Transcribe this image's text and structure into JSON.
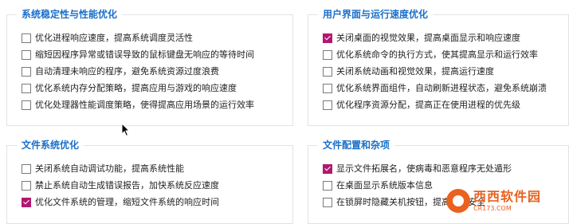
{
  "groups": [
    {
      "title": "系统稳定性与性能优化",
      "options": [
        {
          "label": "优化进程响应速度，提高系统调度灵活性",
          "checked": false
        },
        {
          "label": "缩短因程序异常或错误导致的鼠标键盘无响应的等待时间",
          "checked": false
        },
        {
          "label": "自动清理未响应的程序，避免系统资源过度浪费",
          "checked": false
        },
        {
          "label": "优化系统内存分配策略，提高应用与游戏的响应速度",
          "checked": false
        },
        {
          "label": "优化处理器性能调度策略，使得提高应用场景的运行效率",
          "checked": false
        }
      ]
    },
    {
      "title": "用户界面与运行速度优化",
      "options": [
        {
          "label": "关闭桌面的视觉效果，提高桌面显示和响应速度",
          "checked": true
        },
        {
          "label": "优化系统命令的执行方式，使其提高显示和运行效率",
          "checked": false
        },
        {
          "label": "关闭系统动画和视觉效果，提高运行速度",
          "checked": false
        },
        {
          "label": "优化系统界面组件，自动刷新进程状态，避免系统崩溃",
          "checked": false
        },
        {
          "label": "优化程序资源分配，提高正在使用进程的优先级",
          "checked": false
        }
      ]
    },
    {
      "title": "文件系统优化",
      "options": [
        {
          "label": "关闭系统自动调试功能，提高系统性能",
          "checked": false
        },
        {
          "label": "禁止系统自动生成错误报告，加快系统反应速度",
          "checked": false
        },
        {
          "label": "优化文件系统的管理，缩短文件系统的响应时间",
          "checked": true
        }
      ]
    },
    {
      "title": "文件配置和杂项",
      "options": [
        {
          "label": "显示文件拓展名，使病毒和恶意程序无处遁形",
          "checked": true
        },
        {
          "label": "在桌面显示系统版本信息",
          "checked": false
        },
        {
          "label": "在锁屏时隐藏关机按钮，提高系统安全",
          "checked": false
        }
      ]
    }
  ],
  "watermark": {
    "main": "西西软件园",
    "sub": "CR173.COM"
  },
  "colors": {
    "title": "#1a6fc9",
    "checked": "#b2176f",
    "watermark": "#e9621e"
  }
}
